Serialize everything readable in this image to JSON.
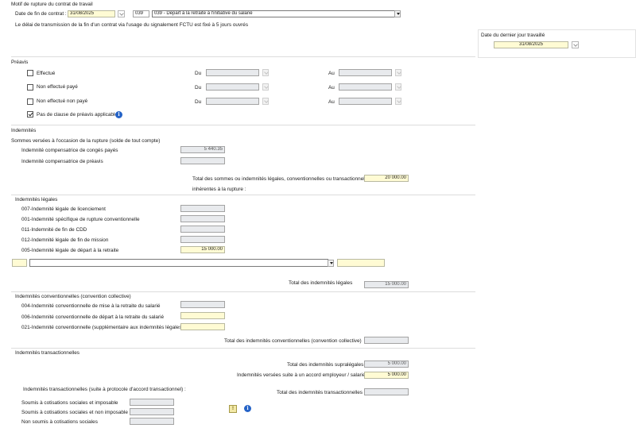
{
  "motif": {
    "title": "Motif de rupture du contrat de travail",
    "date_label": "Date de fin de contrat :",
    "date_value": "31/08/2025",
    "code": "039",
    "motif_selected": "039 - Départ à la retraite à l'initiative du salarié",
    "notice": "Le délai de transmission de la fin d'un contrat via l'usage du signalement FCTU est fixé à 5 jours ouvrés"
  },
  "dernier_jour": {
    "label": "Date du dernier jour travaillé",
    "value": "31/08/2025"
  },
  "preavis": {
    "title": "Préavis",
    "du_label": "Du",
    "au_label": "Au",
    "rows": [
      {
        "label": "Effectué",
        "checked": false
      },
      {
        "label": "Non effectué payé",
        "checked": false
      },
      {
        "label": "Non effectué non payé",
        "checked": false
      },
      {
        "label": "Pas de clause de préavis applicable",
        "checked": true
      }
    ]
  },
  "indemnites": {
    "title": "Indemnités",
    "sommes_title": "Sommes versées à l'occasion de la rupture (solde de tout compte)",
    "conges_label": "Indemnité compensatrice de congés payés",
    "conges_value": "5 440.35",
    "preavis_label": "Indemnité compensatrice de préavis",
    "preavis_value": "",
    "total_label_1": "Total des sommes ou indemnités légales, conventionnelles ou transactionnelles",
    "total_label_2": "inhérentes à la rupture :",
    "total_value": "20 000.00"
  },
  "legales": {
    "title": "Indemnités légales",
    "items": [
      {
        "label": "007-Indemnité légale de licenciement",
        "value": ""
      },
      {
        "label": "001-Indemnité spécifique de rupture conventionnelle",
        "value": ""
      },
      {
        "label": "011-Indemnité de fin de CDD",
        "value": ""
      },
      {
        "label": "012-Indemnité légale de fin de mission",
        "value": ""
      },
      {
        "label": "005-Indemnité légale de départ à la retraite",
        "value": "15 000.00"
      }
    ],
    "total_label": "Total des indemnités légales",
    "total_value": "15 000.00"
  },
  "conventionnelles": {
    "title": "Indemnités conventionnelles (convention collective)",
    "items": [
      {
        "label": "004-Indemnité conventionnelle de mise à la retraite du salarié",
        "value": ""
      },
      {
        "label": "006-Indemnité conventionnelle de départ à la retraite du salarié",
        "value": ""
      },
      {
        "label": "021-Indemnité conventionnelle (supplémentaire aux indemnités légales)",
        "value": ""
      }
    ],
    "total_label": "Total des indemnités conventionnelles (convention collective)",
    "total_value": ""
  },
  "transactionnelles": {
    "title": "Indemnités transactionnelles",
    "supralegales_label": "Total des indemnités supralégales",
    "supralegales_value": "5 000.00",
    "accord_label": "Indemnités versées suite à un accord employeur / salarié",
    "accord_value": "5 000.00",
    "protocole_title": "Indemnités transactionnelles (suite à protocole d'accord transactionnel) :",
    "total_label": "Total des indemnités transactionnelles",
    "total_value": "",
    "soumis_items": [
      "Soumis à cotisations sociales et imposable",
      "Soumis à cotisations sociales et non imposable",
      "Non soumis à cotisations sociales"
    ]
  },
  "icons": {
    "info": "i",
    "warning": "!"
  }
}
